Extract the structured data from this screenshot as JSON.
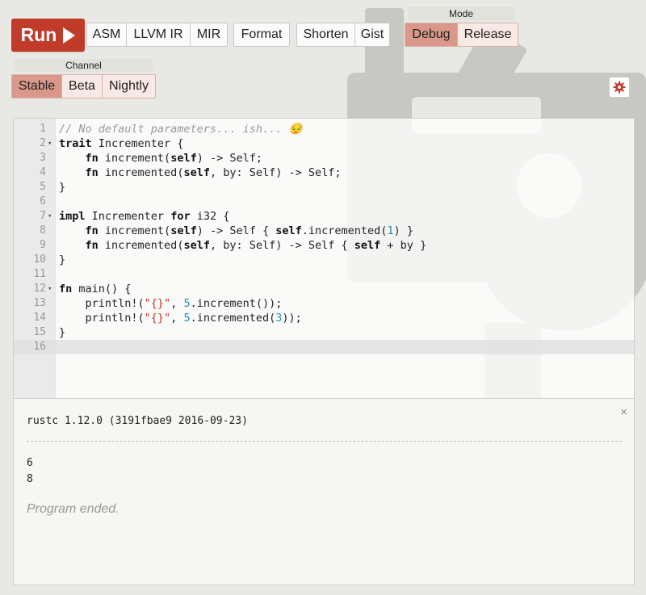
{
  "toolbar": {
    "run_label": "Run",
    "asm_label": "ASM",
    "llvm_label": "LLVM IR",
    "mir_label": "MIR",
    "format_label": "Format",
    "shorten_label": "Shorten",
    "gist_label": "Gist",
    "mode_legend": "Mode",
    "debug_label": "Debug",
    "release_label": "Release",
    "selected_mode": "Debug",
    "channel_legend": "Channel",
    "stable_label": "Stable",
    "beta_label": "Beta",
    "nightly_label": "Nightly",
    "selected_channel": "Stable",
    "config_icon": "gear-icon"
  },
  "editor": {
    "lines": [
      "// No default parameters... ish... 😔",
      "trait Incrementer {",
      "    fn increment(self) -> Self;",
      "    fn incremented(self, by: Self) -> Self;",
      "}",
      "",
      "impl Incrementer for i32 {",
      "    fn increment(self) -> Self { self.incremented(1) }",
      "    fn incremented(self, by: Self) -> Self { self + by }",
      "}",
      "",
      "fn main() {",
      "    println!(\"{}\", 5.increment());",
      "    println!(\"{}\", 5.incremented(3));",
      "}",
      ""
    ],
    "line_numbers": [
      "1",
      "2",
      "3",
      "4",
      "5",
      "6",
      "7",
      "8",
      "9",
      "10",
      "11",
      "12",
      "13",
      "14",
      "15",
      "16"
    ],
    "fold_marker": "▾"
  },
  "output": {
    "close_label": "×",
    "compiler_version": "rustc 1.12.0 (3191fbae9 2016-09-23)",
    "stdout_lines": [
      "6",
      "8"
    ],
    "status": "Program ended."
  },
  "colors": {
    "run": "#c13b2a",
    "selected": "#d99889",
    "group_bg": "#f9e9e5",
    "background": "#e8e8e4"
  }
}
